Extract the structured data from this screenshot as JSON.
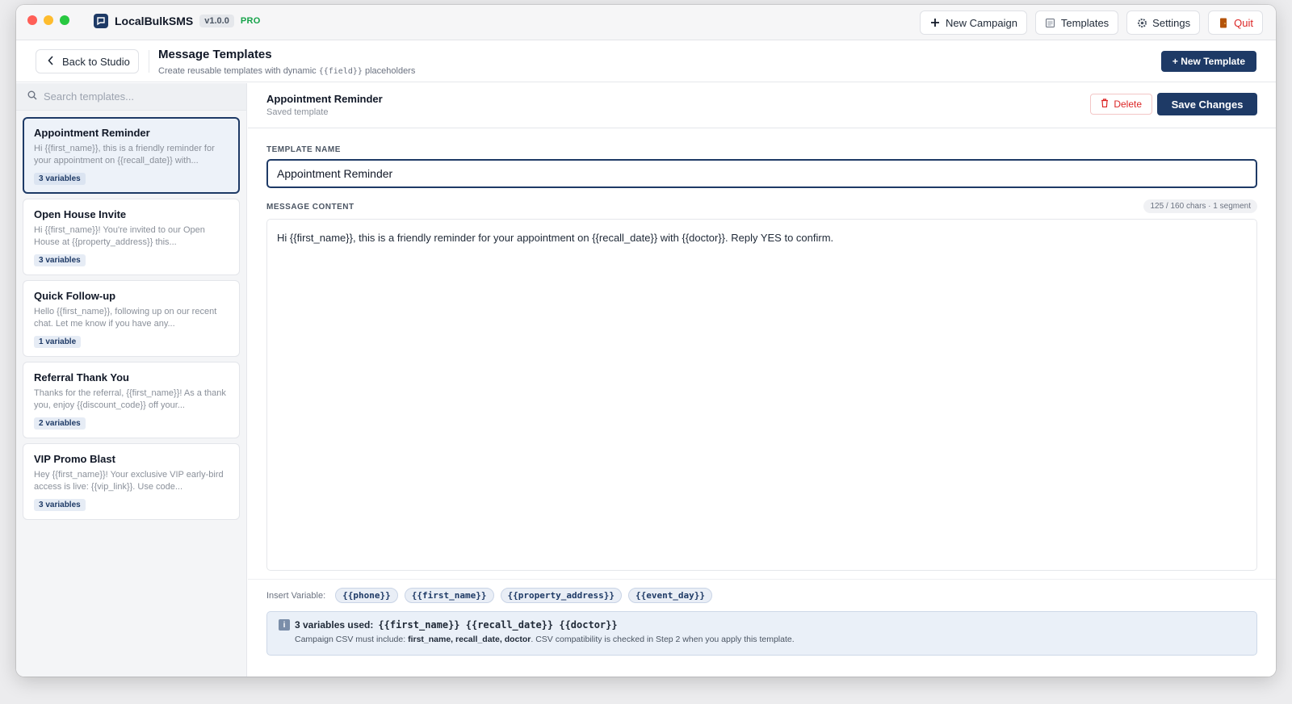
{
  "app": {
    "name": "LocalBulkSMS",
    "version": "v1.0.0",
    "tier": "PRO"
  },
  "toolbar": {
    "new_campaign": "New Campaign",
    "templates": "Templates",
    "settings": "Settings",
    "quit": "Quit"
  },
  "header": {
    "back_label": "Back to Studio",
    "title": "Message Templates",
    "subtitle_prefix": "Create reusable templates with dynamic",
    "subtitle_code": "{{field}}",
    "subtitle_suffix": "placeholders",
    "new_template": "+ New Template"
  },
  "sidebar": {
    "search_placeholder": "Search templates...",
    "templates": [
      {
        "name": "Appointment Reminder",
        "preview": "Hi {{first_name}}, this is a friendly reminder for your appointment on {{recall_date}} with...",
        "badge": "3 variables"
      },
      {
        "name": "Open House Invite",
        "preview": "Hi {{first_name}}! You're invited to our Open House at {{property_address}} this...",
        "badge": "3 variables"
      },
      {
        "name": "Quick Follow-up",
        "preview": "Hello {{first_name}}, following up on our recent chat. Let me know if you have any...",
        "badge": "1 variable"
      },
      {
        "name": "Referral Thank You",
        "preview": "Thanks for the referral, {{first_name}}! As a thank you, enjoy {{discount_code}} off your...",
        "badge": "2 variables"
      },
      {
        "name": "VIP Promo Blast",
        "preview": "Hey {{first_name}}! Your exclusive VIP early-bird access is live: {{vip_link}}. Use code...",
        "badge": "3 variables"
      }
    ]
  },
  "editor": {
    "title": "Appointment Reminder",
    "status": "Saved template",
    "delete_label": "Delete",
    "save_label": "Save Changes",
    "name_label": "TEMPLATE NAME",
    "name_value": "Appointment Reminder",
    "content_label": "MESSAGE CONTENT",
    "char_count": "125 / 160 chars · 1 segment",
    "content_value": "Hi {{first_name}}, this is a friendly reminder for your appointment on {{recall_date}} with {{doctor}}. Reply YES to confirm.",
    "insert_label": "Insert Variable:",
    "variables": [
      "{{phone}}",
      "{{first_name}}",
      "{{property_address}}",
      "{{event_day}}"
    ]
  },
  "info": {
    "used_prefix": "3 variables used:",
    "used_vars": "{{first_name}} {{recall_date}} {{doctor}}",
    "csv_prefix": "Campaign CSV must include:",
    "csv_fields": "first_name, recall_date, doctor",
    "csv_suffix": ". CSV compatibility is checked in Step 2 when you apply this template."
  },
  "colors": {
    "accent": "#1e3a66",
    "danger": "#dc2626",
    "pro": "#16a34a"
  }
}
